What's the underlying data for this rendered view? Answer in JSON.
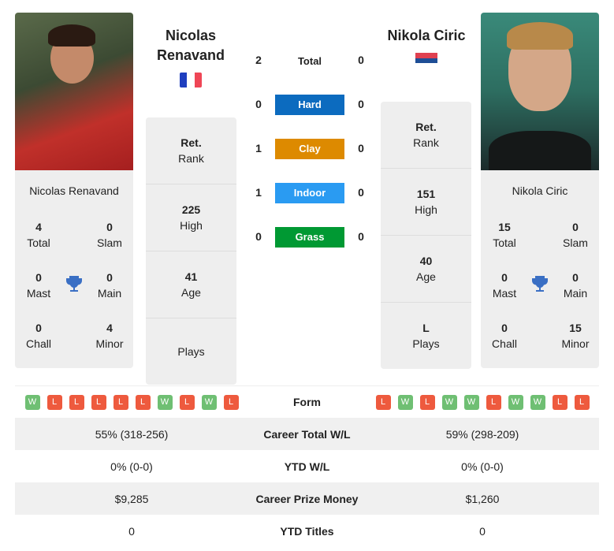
{
  "left": {
    "name": "Nicolas Renavand",
    "name_line1": "Nicolas",
    "name_line2": "Renavand",
    "flag": "france-flag",
    "titles": {
      "total": "4",
      "slam": "0",
      "mast": "0",
      "main": "0",
      "chall": "0",
      "minor": "4"
    },
    "stats": {
      "rank_value": "Ret.",
      "rank_label": "Rank",
      "high_value": "225",
      "high_label": "High",
      "age_value": "41",
      "age_label": "Age",
      "plays_value": "",
      "plays_label": "Plays"
    },
    "form": [
      "W",
      "L",
      "L",
      "L",
      "L",
      "L",
      "W",
      "L",
      "W",
      "L"
    ]
  },
  "right": {
    "name": "Nikola Ciric",
    "flag": "serbia-flag",
    "titles": {
      "total": "15",
      "slam": "0",
      "mast": "0",
      "main": "0",
      "chall": "0",
      "minor": "15"
    },
    "stats": {
      "rank_value": "Ret.",
      "rank_label": "Rank",
      "high_value": "151",
      "high_label": "High",
      "age_value": "40",
      "age_label": "Age",
      "plays_value": "L",
      "plays_label": "Plays"
    },
    "form": [
      "L",
      "W",
      "L",
      "W",
      "W",
      "L",
      "W",
      "W",
      "L",
      "L"
    ]
  },
  "labels": {
    "total": "Total",
    "slam": "Slam",
    "mast": "Mast",
    "main": "Main",
    "chall": "Chall",
    "minor": "Minor"
  },
  "h2h": [
    {
      "label": "Total",
      "left": "2",
      "right": "0",
      "color": ""
    },
    {
      "label": "Hard",
      "left": "0",
      "right": "0",
      "color": "#0c6bbf"
    },
    {
      "label": "Clay",
      "left": "1",
      "right": "0",
      "color": "#dd8a00"
    },
    {
      "label": "Indoor",
      "left": "1",
      "right": "0",
      "color": "#2a9bf2"
    },
    {
      "label": "Grass",
      "left": "0",
      "right": "0",
      "color": "#009933"
    }
  ],
  "table": [
    {
      "label": "Form"
    },
    {
      "label": "Career Total W/L",
      "left": "55% (318-256)",
      "right": "59% (298-209)"
    },
    {
      "label": "YTD W/L",
      "left": "0% (0-0)",
      "right": "0% (0-0)"
    },
    {
      "label": "Career Prize Money",
      "left": "$9,285",
      "right": "$1,260"
    },
    {
      "label": "YTD Titles",
      "left": "0",
      "right": "0"
    }
  ]
}
